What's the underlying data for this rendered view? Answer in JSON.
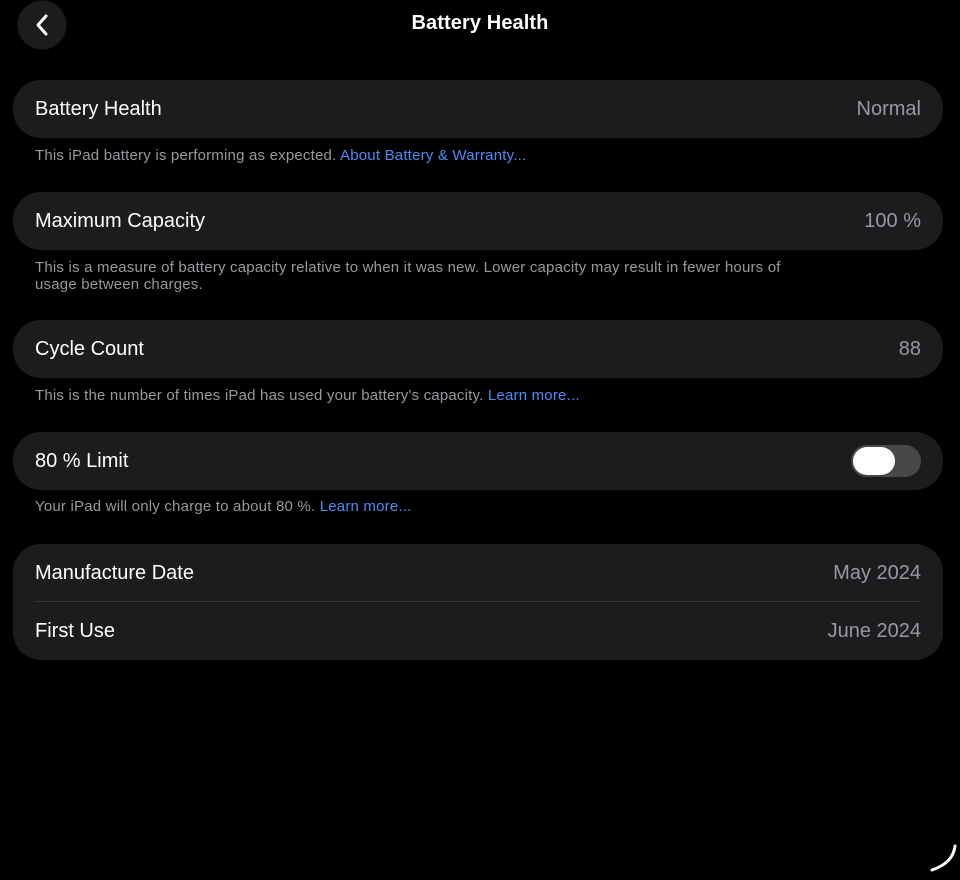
{
  "header": {
    "title": "Battery Health",
    "back_icon": "chevron-left-icon"
  },
  "battery_health": {
    "label": "Battery Health",
    "value": "Normal",
    "footnote": "This iPad battery is performing as expected.",
    "link": "About Battery & Warranty..."
  },
  "maximum_capacity": {
    "label": "Maximum Capacity",
    "value": "100 %",
    "footnote": "This is a measure of battery capacity relative to when it was new. Lower capacity may result in fewer hours of usage between charges."
  },
  "cycle_count": {
    "label": "Cycle Count",
    "value": "88",
    "footnote": "This is the number of times iPad has used your battery's capacity.",
    "link": "Learn more..."
  },
  "limit_80": {
    "label": "80 % Limit",
    "toggle_state": "off",
    "footnote": "Your iPad will only charge to about 80 %.",
    "link": "Learn more..."
  },
  "dates": {
    "manufacture_label": "Manufacture Date",
    "manufacture_value": "May 2024",
    "first_use_label": "First Use",
    "first_use_value": "June 2024"
  },
  "colors": {
    "background": "#000000",
    "card": "#1c1c1e",
    "secondary_text": "#98989f",
    "link": "#4c8bf5",
    "toggle_off_track": "#48484a"
  }
}
